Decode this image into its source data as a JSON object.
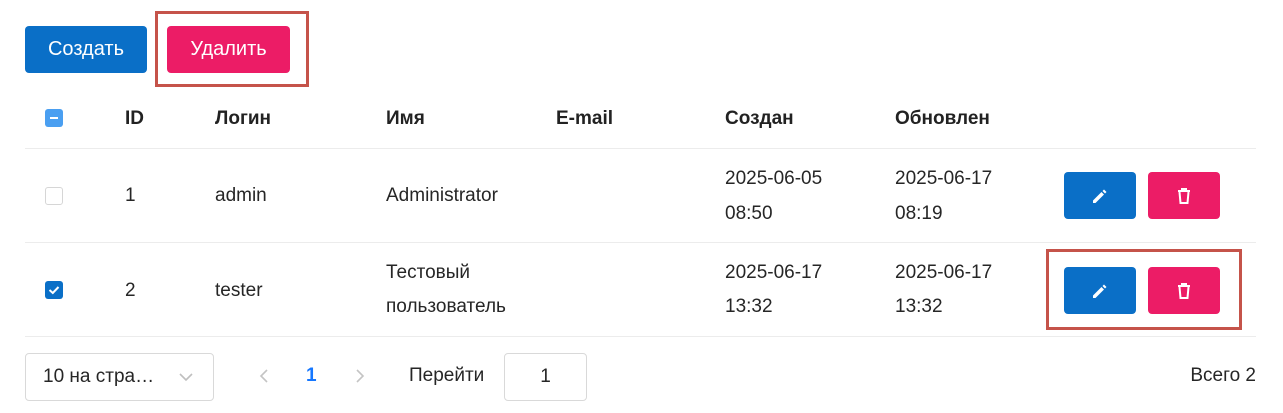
{
  "toolbar": {
    "create_label": "Создать",
    "delete_label": "Удалить"
  },
  "table": {
    "headers": {
      "id": "ID",
      "login": "Логин",
      "name": "Имя",
      "email": "E-mail",
      "created": "Создан",
      "updated": "Обновлен"
    },
    "rows": [
      {
        "checked": false,
        "id": "1",
        "login": "admin",
        "name": "Administrator",
        "name2": "",
        "email": "",
        "created_date": "2025-06-05",
        "created_time": "08:50",
        "updated_date": "2025-06-17",
        "updated_time": "08:19"
      },
      {
        "checked": true,
        "id": "2",
        "login": "tester",
        "name": "Тестовый",
        "name2": "пользователь",
        "email": "",
        "created_date": "2025-06-17",
        "created_time": "13:32",
        "updated_date": "2025-06-17",
        "updated_time": "13:32"
      }
    ]
  },
  "pagination": {
    "page_size": "10 на стра…",
    "current_page": "1",
    "goto_label": "Перейти",
    "goto_value": "1",
    "total": "Всего 2"
  },
  "colors": {
    "primary": "#0a6fc7",
    "danger": "#ec1c66",
    "highlight": "#c5534a"
  }
}
